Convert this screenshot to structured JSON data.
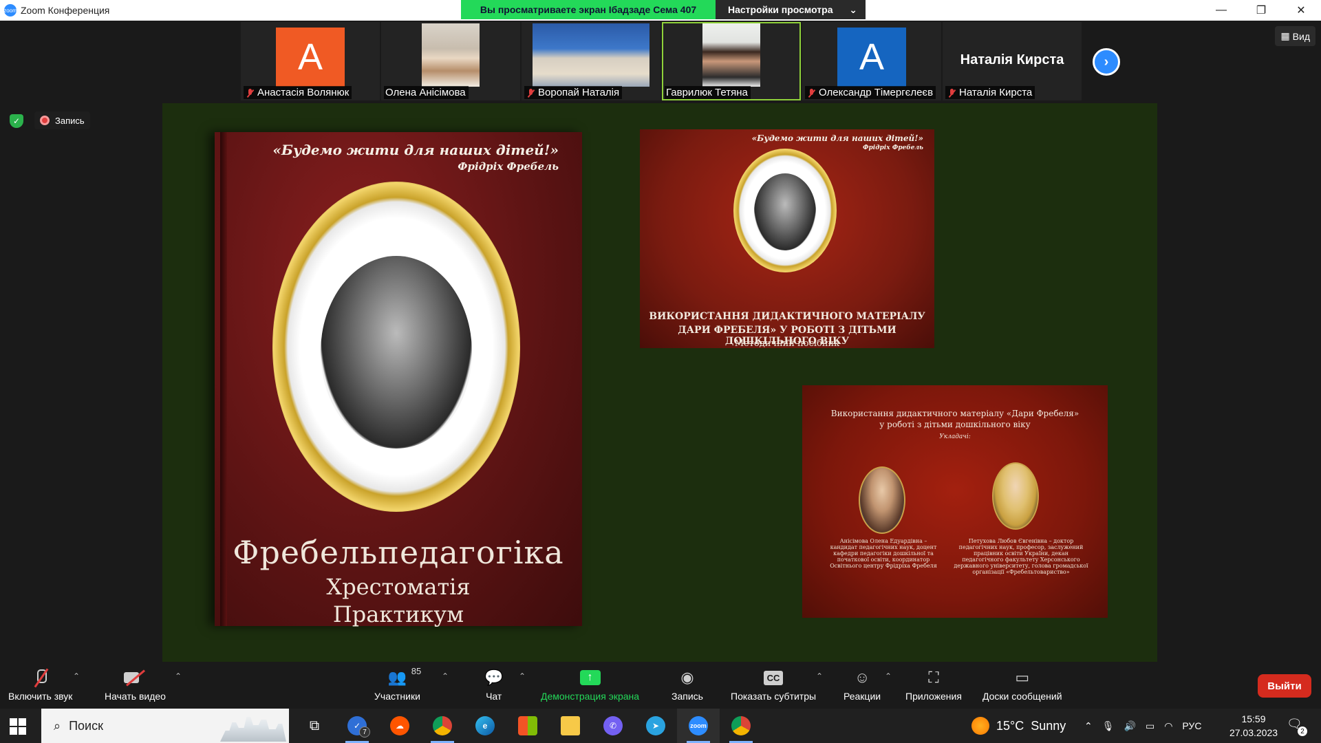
{
  "window": {
    "app_title": "Zoom Конференция",
    "share_banner": "Вы просматриваете экран Ібадзаде Сема 407",
    "view_settings": "Настройки просмотра",
    "controls": [
      "—",
      "❐",
      "✕"
    ]
  },
  "view_button": "Вид",
  "recording_label": "Запись",
  "participants": [
    {
      "name": "Анастасія Волянюк",
      "initial": "A",
      "avatar_color": "#f05a24",
      "muted": true,
      "type": "initial"
    },
    {
      "name": "Олена Анісімова",
      "muted": false,
      "type": "photo"
    },
    {
      "name": "Воропай Наталія",
      "muted": true,
      "type": "photo"
    },
    {
      "name": "Гаврилюк Тетяна",
      "muted": false,
      "type": "photo",
      "active": true
    },
    {
      "name": "Олександр Тімергєлеєв",
      "initial": "A",
      "avatar_color": "#1565c0",
      "muted": true,
      "type": "initial"
    },
    {
      "name": "Наталія Кирста",
      "display_name": "Наталія Кирста",
      "muted": true,
      "type": "name"
    }
  ],
  "shared": {
    "big_book": {
      "quote": "«Будемо жити для наших дітей!»",
      "author": "Фрідріх Фребель",
      "title": "Фребельпедагогіка",
      "line2": "Хрестоматія",
      "line3": "Практикум"
    },
    "small_book": {
      "quote": "«Будемо жити для наших дітей!»",
      "author": "Фрідріх Фребель",
      "title_line1": "ВИКОРИСТАННЯ ДИДАКТИЧНОГО МАТЕРІАЛУ",
      "title_line2": "ДАРИ ФРЕБЕЛЯ» У РОБОТІ З ДІТЬМИ ДОШКІЛЬНОГО ВІКУ",
      "subtitle": "Методичний посібник"
    },
    "back_cover": {
      "head1": "Використання дидактичного матеріалу «Дари Фребеля»",
      "head2": "у роботі з дітьми дошкільного віку",
      "compilers": "Укладачі:",
      "author1": "Анісімова Олена Едуардівна – кандидат педагогічних наук, доцент кафедри педагогіки дошкільної та початкової освіти, координатор Освітнього центру Фрідріха Фребеля",
      "author2": "Петухова Любов Євгенівна – доктор педагогічних наук, професор, заслужений працівник освіти України, декан педагогічного факультету Херсонського державного університету, голова громадської організації «Фребельтовариство»"
    }
  },
  "toolbar": {
    "audio": "Включить звук",
    "video": "Начать видео",
    "participants": "Участники",
    "participants_count": "85",
    "chat": "Чат",
    "share": "Демонстрация экрана",
    "record": "Запись",
    "captions": "Показать субтитры",
    "reactions": "Реакции",
    "apps": "Приложения",
    "whiteboards": "Доски сообщений",
    "leave": "Выйти"
  },
  "taskbar": {
    "search": "Поиск",
    "todo_badge": "7",
    "weather_temp": "15°C",
    "weather_text": "Sunny",
    "language": "РУС",
    "time": "15:59",
    "date": "27.03.2023",
    "notifications": "2"
  }
}
